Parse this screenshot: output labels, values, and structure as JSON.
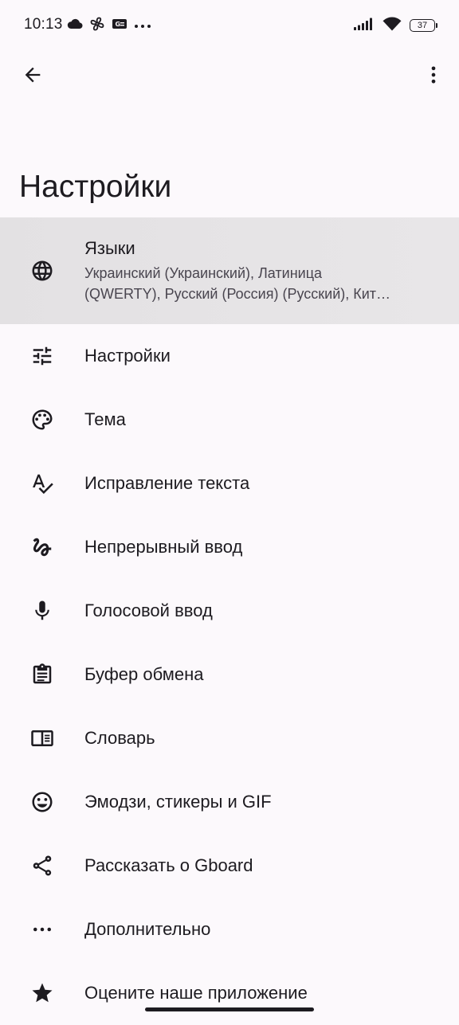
{
  "status_bar": {
    "time": "10:13",
    "battery_level": "37",
    "left_icons": [
      "cloud-icon",
      "fan-icon",
      "keyboard-badge-icon",
      "more-notifications-icon"
    ],
    "right_icons": [
      "signal-icon",
      "wifi-icon",
      "battery-icon"
    ]
  },
  "app_bar": {
    "back_icon": "arrow-back-icon",
    "menu_icon": "more-vert-icon"
  },
  "page": {
    "title": "Настройки"
  },
  "settings": {
    "items": [
      {
        "title": "Языки",
        "subtitle_line1": "Украинский (Украинский), Латиница",
        "subtitle_line2": "(QWERTY), Русский (Россия) (Русский), Кит…",
        "icon": "globe-icon"
      },
      {
        "title": "Настройки",
        "icon": "tune-icon"
      },
      {
        "title": "Тема",
        "icon": "palette-icon"
      },
      {
        "title": "Исправление текста",
        "icon": "spellcheck-icon"
      },
      {
        "title": "Непрерывный ввод",
        "icon": "gesture-icon"
      },
      {
        "title": "Голосовой ввод",
        "icon": "mic-icon"
      },
      {
        "title": "Буфер обмена",
        "icon": "clipboard-icon"
      },
      {
        "title": "Словарь",
        "icon": "dictionary-icon"
      },
      {
        "title": "Эмодзи, стикеры и GIF",
        "icon": "emoji-icon"
      },
      {
        "title": "Рассказать о Gboard",
        "icon": "share-icon"
      },
      {
        "title": "Дополнительно",
        "icon": "more-horiz-icon"
      },
      {
        "title": "Оцените наше приложение",
        "icon": "star-icon"
      }
    ]
  }
}
